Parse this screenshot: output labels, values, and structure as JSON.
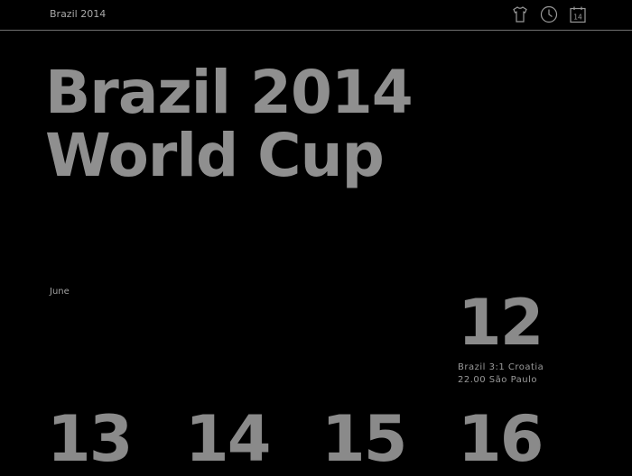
{
  "header": {
    "brand": "Brazil 2014",
    "icons": [
      {
        "name": "shirt-icon"
      },
      {
        "name": "clock-icon"
      },
      {
        "name": "calendar-icon",
        "label": "14"
      }
    ]
  },
  "hero": {
    "line1": "Brazil 2014",
    "line2": "World Cup"
  },
  "schedule": {
    "month": "June",
    "days": [
      {
        "day": "12",
        "match": "Brazil 3:1 Croatia",
        "time_venue": "22.00 São Paulo"
      },
      {
        "day": "13"
      },
      {
        "day": "14"
      },
      {
        "day": "15"
      },
      {
        "day": "16"
      }
    ]
  }
}
